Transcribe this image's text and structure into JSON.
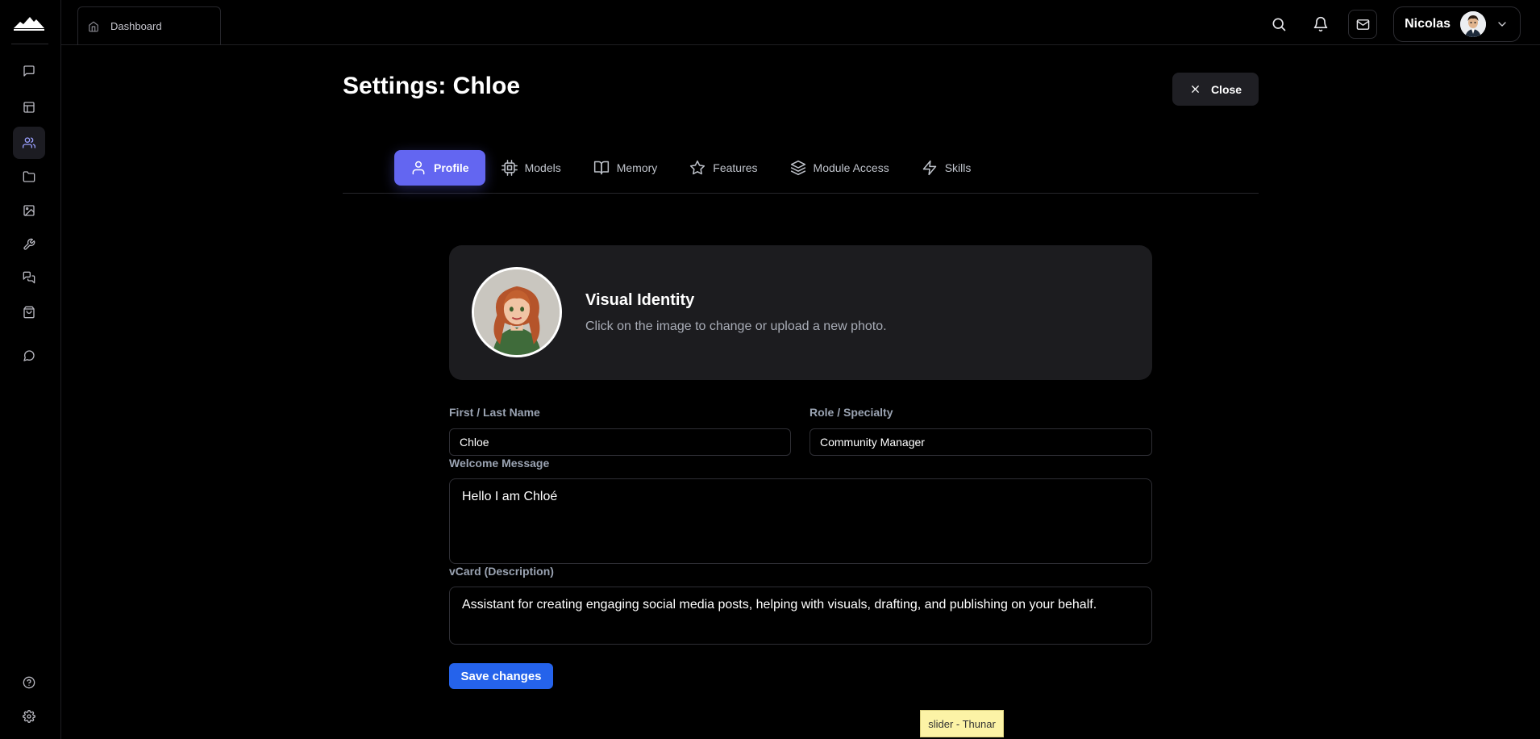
{
  "topbar": {
    "tab_label": "Dashboard",
    "user_name": "Nicolas"
  },
  "sidebar": {
    "items": [
      {
        "icon": "chat-bubble-icon"
      },
      {
        "icon": "layout-icon"
      },
      {
        "icon": "users-icon",
        "active": true
      },
      {
        "icon": "folder-icon"
      },
      {
        "icon": "image-icon"
      },
      {
        "icon": "wrench-icon"
      },
      {
        "icon": "messages-icon"
      },
      {
        "icon": "shopping-bag-icon"
      },
      {
        "icon": "chat-round-icon"
      }
    ],
    "bottom": [
      {
        "icon": "help-icon"
      },
      {
        "icon": "settings-icon"
      }
    ]
  },
  "page": {
    "title": "Settings: Chloe",
    "close_label": "Close"
  },
  "tabs": [
    {
      "label": "Profile",
      "icon": "user-icon",
      "active": true
    },
    {
      "label": "Models",
      "icon": "cpu-icon"
    },
    {
      "label": "Memory",
      "icon": "book-icon"
    },
    {
      "label": "Features",
      "icon": "star-icon"
    },
    {
      "label": "Module Access",
      "icon": "layers-icon"
    },
    {
      "label": "Skills",
      "icon": "lightning-icon"
    }
  ],
  "visual_identity": {
    "title": "Visual Identity",
    "subtitle": "Click on the image to change or upload a new photo."
  },
  "form": {
    "name_label": "First / Last Name",
    "name_value": "Chloe",
    "role_label": "Role / Specialty",
    "role_value": "Community Manager",
    "welcome_label": "Welcome Message",
    "welcome_value": "Hello I am Chloé",
    "vcard_label": "vCard (Description)",
    "vcard_value": "Assistant for creating engaging social media posts, helping with visuals, drafting, and publishing on your behalf."
  },
  "save_label": "Save changes",
  "tooltip": "slider - Thunar",
  "colors": {
    "accent": "#6366f1",
    "save": "#2563eb",
    "tooltip_bg": "#fcf3a6"
  }
}
